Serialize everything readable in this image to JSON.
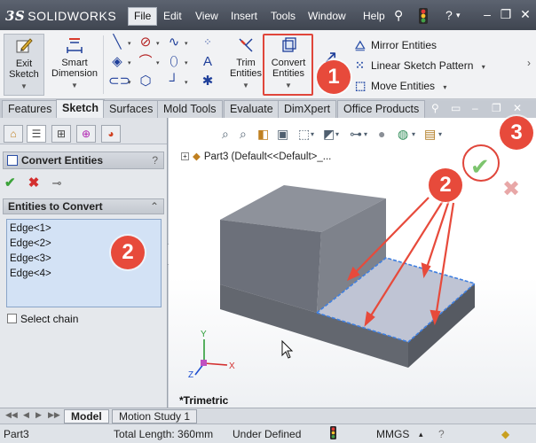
{
  "app": {
    "brand": "SOLIDWORKS",
    "brand_prefix": "3S"
  },
  "menus": [
    "File",
    "Edit",
    "View",
    "Insert",
    "Tools",
    "Window",
    "Help"
  ],
  "ribbon": {
    "exit_sketch": "Exit Sketch",
    "smart_dimension": "Smart Dimension",
    "trim_entities": "Trim Entities",
    "convert_entities": "Convert Entities",
    "mirror_entities": "Mirror Entities",
    "linear_pattern": "Linear Sketch Pattern",
    "move_entities": "Move Entities"
  },
  "tabs": [
    "Features",
    "Sketch",
    "Surfaces",
    "Mold Tools",
    "Evaluate",
    "DimXpert",
    "Office Products"
  ],
  "active_tab": "Sketch",
  "property_manager": {
    "title": "Convert Entities",
    "help": "?",
    "group_title": "Entities to Convert",
    "entities": [
      "Edge<1>",
      "Edge<2>",
      "Edge<3>",
      "Edge<4>"
    ],
    "select_chain": "Select chain"
  },
  "graphics": {
    "tree_item": "Part3  (Default<<Default>_...",
    "view_label": "*Trimetric",
    "triad": {
      "x": "X",
      "y": "Y",
      "z": "Z"
    }
  },
  "bottom_tabs": [
    "Model",
    "Motion Study 1"
  ],
  "status": {
    "part": "Part3",
    "length": "Total Length: 360mm",
    "state": "Under Defined",
    "units": "MMGS"
  },
  "callouts": [
    "1",
    "2",
    "2",
    "3"
  ],
  "colors": {
    "callout": "#e74a3b",
    "selection": "#3f7fe0",
    "model_face": "#6c707a"
  }
}
